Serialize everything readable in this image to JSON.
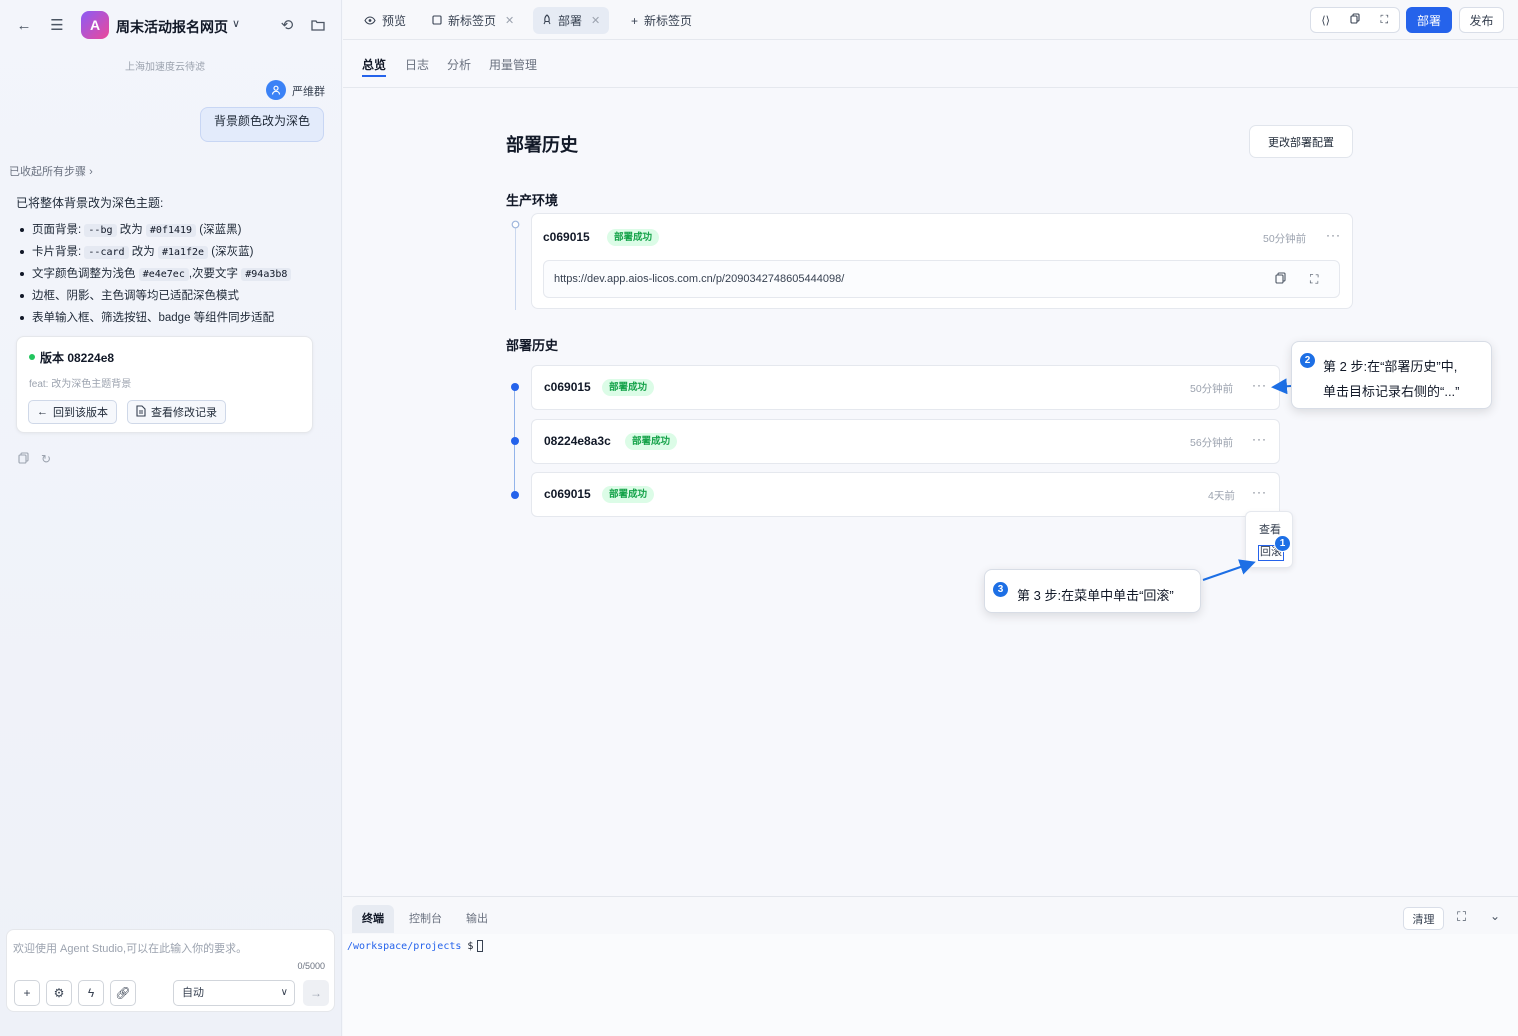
{
  "sidebar": {
    "app_logo_letter": "A",
    "app_title": "周末活动报名网页",
    "meta_text": "上海加速度云待滤",
    "user": {
      "name": "严维群"
    },
    "user_message": "背景颜色改为深色",
    "collapsed_steps": "已收起所有步骤",
    "ai_intro": "已将整体背景改为深色主题:",
    "ai_items": [
      {
        "p1": "页面背景:",
        "c1": "--bg",
        "p2": "改为",
        "c2": "#0f1419",
        "p3": "(深蓝黑)"
      },
      {
        "p1": "卡片背景:",
        "c1": "--card",
        "p2": "改为",
        "c2": "#1a1f2e",
        "p3": "(深灰蓝)"
      },
      {
        "p1": "文字颜色调整为浅色",
        "c1": "#e4e7ec",
        "p2": ",次要文字",
        "c2": "#94a3b8",
        "p3": ""
      },
      {
        "p1": "边框、阴影、主色调等均已适配深色模式"
      },
      {
        "p1": "表单输入框、筛选按钮、badge 等组件同步适配"
      }
    ],
    "version_card": {
      "title": "版本 08224e8",
      "subtitle": "feat: 改为深色主题背景",
      "rollback_label": "回到该版本",
      "view_changes_label": "查看修改记录"
    },
    "composer": {
      "placeholder": "欢迎使用 Agent Studio,可以在此输入你的要求。",
      "counter": "0/5000",
      "mode": "自动"
    }
  },
  "tabs": [
    {
      "icon": "eye-icon",
      "label": "预览",
      "closable": false,
      "active": false
    },
    {
      "icon": "square-icon",
      "label": "新标签页",
      "closable": true,
      "active": false
    },
    {
      "icon": "rocket-icon",
      "label": "部署",
      "closable": true,
      "active": true
    }
  ],
  "new_tab_label": "新标签页",
  "toolbar": {
    "deploy_label": "部署",
    "publish_label": "发布"
  },
  "subtabs": [
    "总览",
    "日志",
    "分析",
    "用量管理"
  ],
  "page": {
    "title": "部署历史",
    "config_button": "更改部署配置",
    "production_label": "生产环境",
    "production": {
      "hash": "c069015",
      "status": "部署成功",
      "time": "50分钟前",
      "url": "https://dev.app.aios-licos.com.cn/p/2090342748605444098/"
    },
    "history_label": "部署历史",
    "history": [
      {
        "hash": "c069015",
        "status": "部署成功",
        "time": "50分钟前"
      },
      {
        "hash": "08224e8a3c",
        "status": "部署成功",
        "time": "56分钟前"
      },
      {
        "hash": "c069015",
        "status": "部署成功",
        "time": "4天前"
      }
    ],
    "menu": {
      "view": "查看",
      "rollback": "回滚"
    }
  },
  "annotations": {
    "step1_num": "1",
    "step2_num": "2",
    "step2_line1": "第 2 步:在“部署历史”中,",
    "step2_line2": "单击目标记录右侧的“...”",
    "step3_num": "3",
    "step3_text": "第 3 步:在菜单中单击“回滚”"
  },
  "terminal": {
    "tabs": [
      "终端",
      "控制台",
      "输出"
    ],
    "clear_label": "清理",
    "path": "/workspace/projects",
    "prompt": "$"
  },
  "colors": {
    "accent": "#2563eb",
    "success_bg": "#dcfce7",
    "success_text": "#16a34a"
  }
}
